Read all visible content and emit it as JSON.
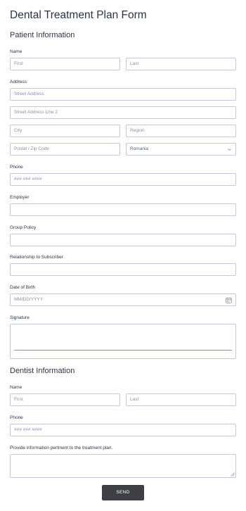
{
  "form": {
    "title": "Dental Treatment Plan Form",
    "send_label": "SEND"
  },
  "patient": {
    "section_title": "Patient Information",
    "name_label": "Name",
    "first_placeholder": "First",
    "last_placeholder": "Last",
    "address_label": "Address",
    "street1_placeholder": "Street Address",
    "street2_placeholder": "Street Address Line 2",
    "city_placeholder": "City",
    "region_placeholder": "Region",
    "postal_placeholder": "Postal / Zip Code",
    "country_value": "Romania",
    "phone_label": "Phone",
    "phone_placeholder": "### ### ####",
    "employer_label": "Employer",
    "group_policy_label": "Group Policy",
    "relationship_label": "Relationship to Subscriber",
    "dob_label": "Date of Birth",
    "dob_placeholder": "MM/DD/YYYY",
    "signature_label": "Signature"
  },
  "dentist": {
    "section_title": "Dentist Information",
    "name_label": "Name",
    "first_placeholder": "First",
    "last_placeholder": "Last",
    "phone_label": "Phone",
    "phone_placeholder": "### ### ####",
    "info_label": "Provide information pertinent to the treatment plan."
  },
  "icons": {
    "dropdown": "chevron-down-icon",
    "calendar": "calendar-icon",
    "resize": "resize-handle-icon"
  },
  "colors": {
    "border": "#c3cad8",
    "button": "#3d3f44",
    "text": "#2c3345"
  }
}
